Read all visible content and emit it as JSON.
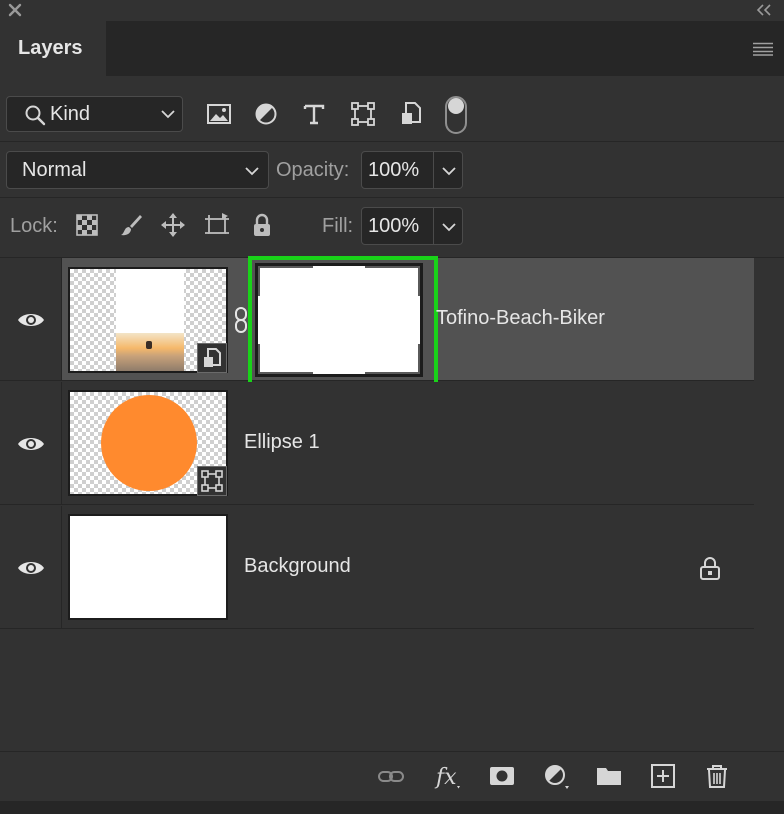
{
  "window": {
    "close_icon": "close-x-icon",
    "collapse_icon": "double-chevron-left-icon"
  },
  "panel": {
    "tab_label": "Layers",
    "menu_icon": "hamburger-menu-icon"
  },
  "filter": {
    "kind_label": "Kind",
    "icons": [
      "pixel-layer-filter-icon",
      "adjustment-layer-filter-icon",
      "type-layer-filter-icon",
      "shape-layer-filter-icon",
      "smart-object-filter-icon"
    ],
    "toggle_state": "on"
  },
  "blend": {
    "mode": "Normal",
    "opacity_label": "Opacity:",
    "opacity_value": "100%"
  },
  "lock": {
    "label": "Lock:",
    "fill_label": "Fill:",
    "fill_value": "100%"
  },
  "layers": [
    {
      "name": "Tofino-Beach-Biker",
      "selected": true,
      "visible": true,
      "has_mask": true,
      "smart_object": true
    },
    {
      "name": "Ellipse 1",
      "selected": false,
      "visible": true,
      "shape_color": "#ff8a2e"
    },
    {
      "name": "Background",
      "selected": false,
      "visible": true,
      "locked": true
    }
  ],
  "highlight_color": "#19d219",
  "bottom_icons": [
    "link-layers-icon",
    "fx-icon",
    "add-mask-icon",
    "adjustment-layer-icon",
    "new-group-icon",
    "new-layer-icon",
    "trash-icon"
  ]
}
